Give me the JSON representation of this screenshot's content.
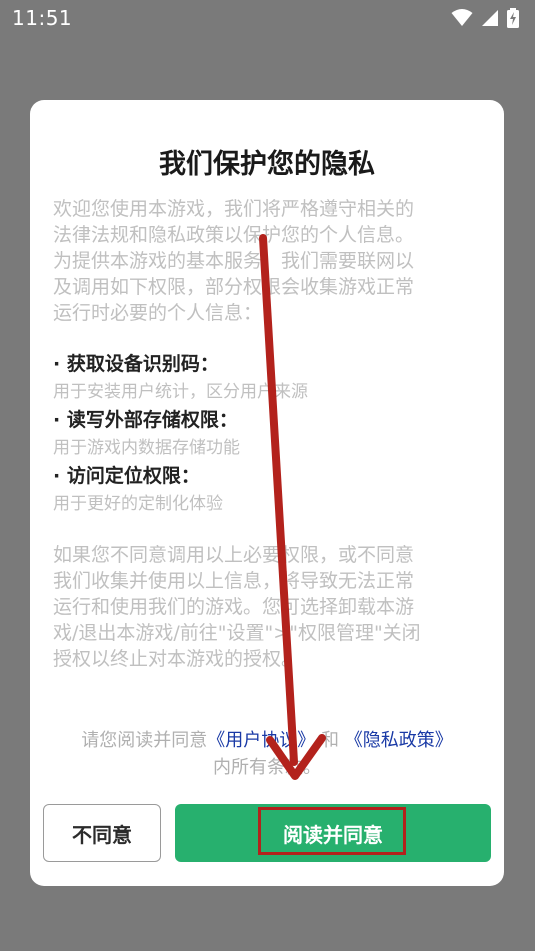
{
  "status_bar": {
    "time": "11:51",
    "icons": [
      "wifi-icon",
      "cell-signal-icon",
      "battery-charging-icon"
    ]
  },
  "dialog": {
    "title": "我们保护您的隐私",
    "intro": [
      "欢迎您使用本游戏，我们将严格遵守相关的",
      "法律法规和隐私政策以保护您的个人信息。",
      "为提供本游戏的基本服务，我们需要联网以",
      "及调用如下权限，部分权限会收集游戏正常",
      "运行时必要的个人信息："
    ],
    "permissions": [
      {
        "title": "· 获取设备识别码：",
        "desc": "用于安装用户统计，区分用户来源"
      },
      {
        "title": "· 读写外部存储权限：",
        "desc": "用于游戏内数据存储功能"
      },
      {
        "title": "· 访问定位权限：",
        "desc": "用于更好的定制化体验"
      }
    ],
    "notice": [
      "如果您不同意调用以上必要权限，或不同意",
      "我们收集并使用以上信息，将导致无法正常",
      "运行和使用我们的游戏。您可选择卸载本游",
      "戏/退出本游戏/前往\"设置\">\"权限管理\"关闭",
      "授权以终止对本游戏的授权。"
    ],
    "agree_note": {
      "prefix": "请您阅读并同意",
      "user_agreement_link": "《用户协议》",
      "and": "和",
      "privacy_policy_link": "《隐私政策》",
      "suffix": "内所有条款。"
    },
    "buttons": {
      "decline": "不同意",
      "accept": "阅读并同意"
    }
  },
  "colors": {
    "overlay": "#7a7a7a",
    "accent_green": "#27b06e",
    "link_blue": "#1a3aa6",
    "annotation_red": "#b3221c"
  }
}
